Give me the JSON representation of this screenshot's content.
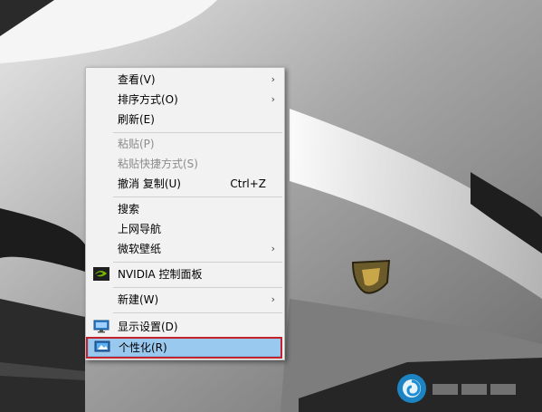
{
  "desktop": {
    "wallpaper": "gray-sports-car",
    "emblem_icon": "car-badge-icon"
  },
  "context_menu": {
    "items": [
      {
        "label": "查看(V)",
        "has_submenu": true,
        "disabled": false
      },
      {
        "label": "排序方式(O)",
        "has_submenu": true,
        "disabled": false
      },
      {
        "label": "刷新(E)",
        "has_submenu": false,
        "disabled": false
      },
      {
        "label": "粘贴(P)",
        "has_submenu": false,
        "disabled": true
      },
      {
        "label": "粘贴快捷方式(S)",
        "has_submenu": false,
        "disabled": true
      },
      {
        "label": "撤消 复制(U)",
        "shortcut": "Ctrl+Z",
        "has_submenu": false,
        "disabled": false
      },
      {
        "label": "搜索",
        "has_submenu": false,
        "disabled": false
      },
      {
        "label": "上网导航",
        "has_submenu": false,
        "disabled": false
      },
      {
        "label": "微软壁纸",
        "has_submenu": true,
        "disabled": false
      },
      {
        "label": "NVIDIA 控制面板",
        "icon": "nvidia-icon",
        "has_submenu": false,
        "disabled": false
      },
      {
        "label": "新建(W)",
        "has_submenu": true,
        "disabled": false
      },
      {
        "label": "显示设置(D)",
        "icon": "display-icon",
        "has_submenu": false,
        "disabled": false
      },
      {
        "label": "个性化(R)",
        "icon": "personalize-icon",
        "has_submenu": false,
        "disabled": false,
        "highlighted": true
      }
    ],
    "submenu_arrow": "›",
    "highlight_color": "#99c9ef",
    "annotation_color": "#c4222b"
  },
  "watermark": {
    "icon": "watermark-logo-icon"
  }
}
